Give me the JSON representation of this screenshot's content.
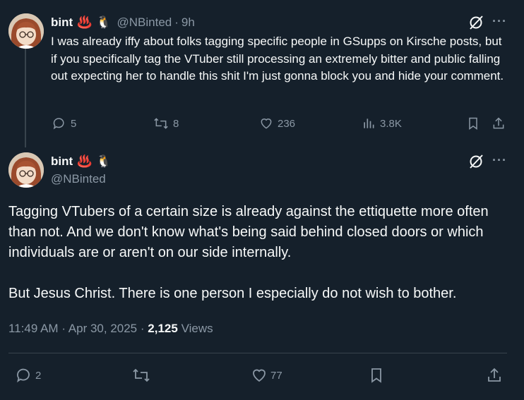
{
  "tweet1": {
    "display_name": "bint",
    "emoji1": "♨️",
    "emoji2": "🐧",
    "handle": "@NBinted",
    "dot": "·",
    "time": "9h",
    "text": "I was already iffy about folks tagging specific people in GSupps on Kirsche posts, but if you specifically tag the VTuber still processing an extremely bitter and public falling out expecting her to handle this shit I'm just gonna block you and hide your comment.",
    "replies": "5",
    "reposts": "8",
    "likes": "236",
    "views": "3.8K",
    "more_label": "···"
  },
  "tweet2": {
    "display_name": "bint",
    "emoji1": "♨️",
    "emoji2": "🐧",
    "handle": "@NBinted",
    "paragraph1": "Tagging VTubers of a certain size is already against the ettiquette more often than not. And we don't know what's being said behind closed doors or which individuals are or aren't on our side internally.",
    "paragraph2": "But Jesus Christ. There is one person I especially do not wish to bother.",
    "time": "11:49 AM",
    "date": "Apr 30, 2025",
    "dot": "·",
    "views_count": "2,125",
    "views_label": "Views",
    "replies": "2",
    "likes": "77",
    "more_label": "···"
  },
  "colors": {
    "background": "#15202b",
    "text": "#f7f9f9",
    "muted": "#8b98a5",
    "divider": "#38444d"
  },
  "icons": [
    "reply-icon",
    "repost-icon",
    "like-icon",
    "views-icon",
    "bookmark-icon",
    "share-icon",
    "grok-icon",
    "more-icon"
  ]
}
